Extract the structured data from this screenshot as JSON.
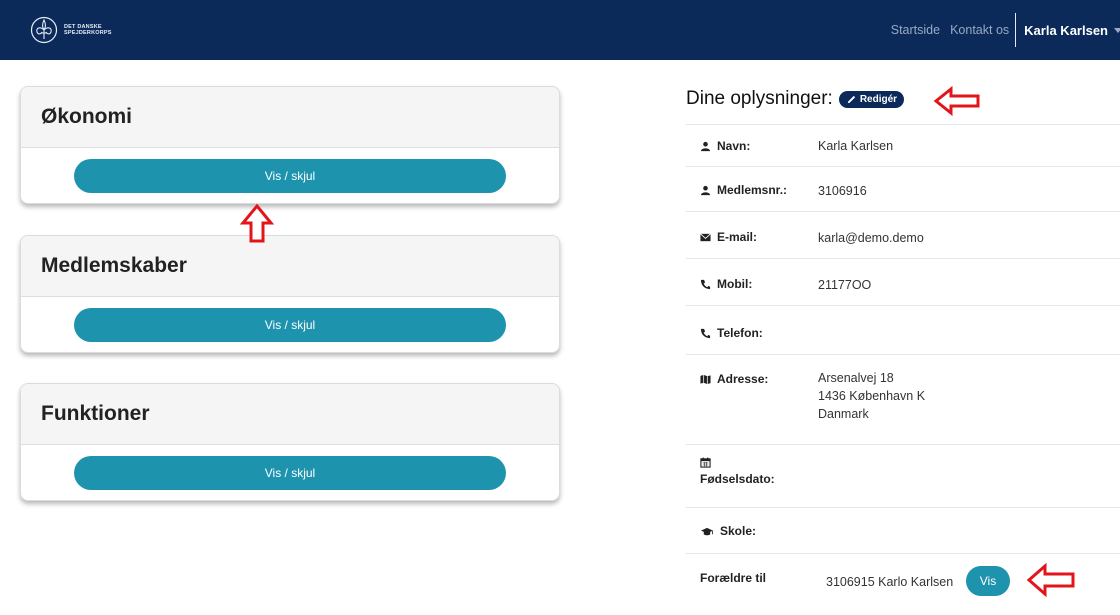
{
  "brand": {
    "logo_text_line1": "DET DANSKE",
    "logo_text_line2": "SPEJDERKORPS"
  },
  "nav": {
    "home": "Startside",
    "contact": "Kontakt os",
    "user": "Karla Karlsen"
  },
  "cards": [
    {
      "title": "Økonomi",
      "button": "Vis / skjul"
    },
    {
      "title": "Medlemskaber",
      "button": "Vis / skjul"
    },
    {
      "title": "Funktioner",
      "button": "Vis / skjul"
    }
  ],
  "info": {
    "title": "Dine oplysninger:",
    "edit_label": "Redigér",
    "rows": [
      {
        "label": "Navn:",
        "value": "Karla Karlsen"
      },
      {
        "label": "Medlemsnr.:",
        "value": "3106916"
      },
      {
        "label": "E-mail:",
        "value": "karla@demo.demo"
      },
      {
        "label": "Mobil:",
        "value": "21177OO"
      },
      {
        "label": "Telefon:",
        "value": ""
      },
      {
        "label": "Adresse:",
        "value_lines": [
          "Arsenalvej 18",
          "1436 København K",
          "Danmark"
        ]
      },
      {
        "label": "Fødselsdato:",
        "value": ""
      },
      {
        "label": "Skole:",
        "value": ""
      },
      {
        "label": "Forældre til",
        "value": "3106915 Karlo Karlsen",
        "button": "Vis"
      }
    ]
  },
  "colors": {
    "navbar": "#0b2a5a",
    "button": "#1e93ad",
    "annotation_arrow": "#e3151a"
  }
}
